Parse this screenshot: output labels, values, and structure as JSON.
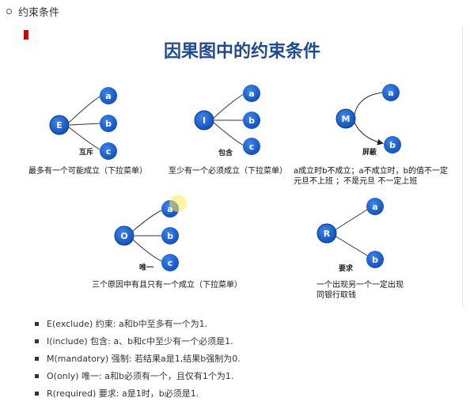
{
  "heading": "约束条件",
  "figure": {
    "title": "因果图中的约束条件",
    "diagrams": [
      {
        "node": "E",
        "targets": [
          "a",
          "b",
          "c"
        ],
        "label": "互斥",
        "desc": [
          "最多有一个可能成立（下拉菜单）"
        ]
      },
      {
        "node": "I",
        "targets": [
          "a",
          "b",
          "c"
        ],
        "label": "包含",
        "desc": [
          "至少有一个必须成立（下拉菜单）"
        ]
      },
      {
        "node": "M",
        "targets": [
          "a",
          "b"
        ],
        "label": "屏蔽",
        "desc": [
          "a成立时b不成立；a不成立时，b的值不一定",
          "元旦不上班 ；不是元旦 不一定上班"
        ]
      },
      {
        "node": "O",
        "targets": [
          "a",
          "b",
          "c"
        ],
        "label": "唯一",
        "desc": [
          "三个原因中有且只有一个成立（下拉菜单）"
        ]
      },
      {
        "node": "R",
        "targets": [
          "a",
          "b"
        ],
        "label": "要求",
        "desc": [
          "一个出现另一个一定出现",
          "同银行取钱"
        ]
      }
    ]
  },
  "bullets": [
    "E(exclude) 约束: a和b中至多有一个为1.",
    "I(include) 包含: a、b和c中至少有一个必须是1.",
    "M(mandatory) 强制: 若结果a是1,结果b强制为0.",
    "O(only) 唯一: a和b必须有一个，且仅有1个为1.",
    "R(required) 要求: a是1时，b必须是1."
  ],
  "colors": {
    "node": "#1559c7",
    "title": "#1f4a8f",
    "accent": "#d40000"
  }
}
